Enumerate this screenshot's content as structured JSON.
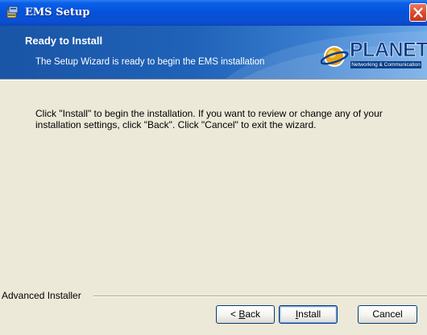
{
  "window": {
    "title": "EMS Setup",
    "icons": {
      "app": "installer-app-icon",
      "close": "close-icon"
    },
    "colors": {
      "titlebar": "#0552d9",
      "banner": "#1f62b8",
      "logo": "#0c3f88",
      "dialog_bg": "#ece9d8"
    }
  },
  "banner": {
    "title": "Ready to Install",
    "subtitle": "The Setup Wizard is ready to begin the EMS installation",
    "logo": {
      "text": "PLANET",
      "tagline": "Networking & Communication",
      "icon": "planet-globe-logo-icon"
    }
  },
  "content": {
    "message": "Click \"Install\" to begin the installation.  If you want to review or change any of your installation settings, click \"Back\".  Click \"Cancel\" to exit the wizard."
  },
  "footer": {
    "brand": "Advanced Installer",
    "buttons": {
      "back_prefix": "< ",
      "back_access": "B",
      "back_rest": "ack",
      "install_access": "I",
      "install_rest": "nstall",
      "cancel": "Cancel"
    }
  }
}
